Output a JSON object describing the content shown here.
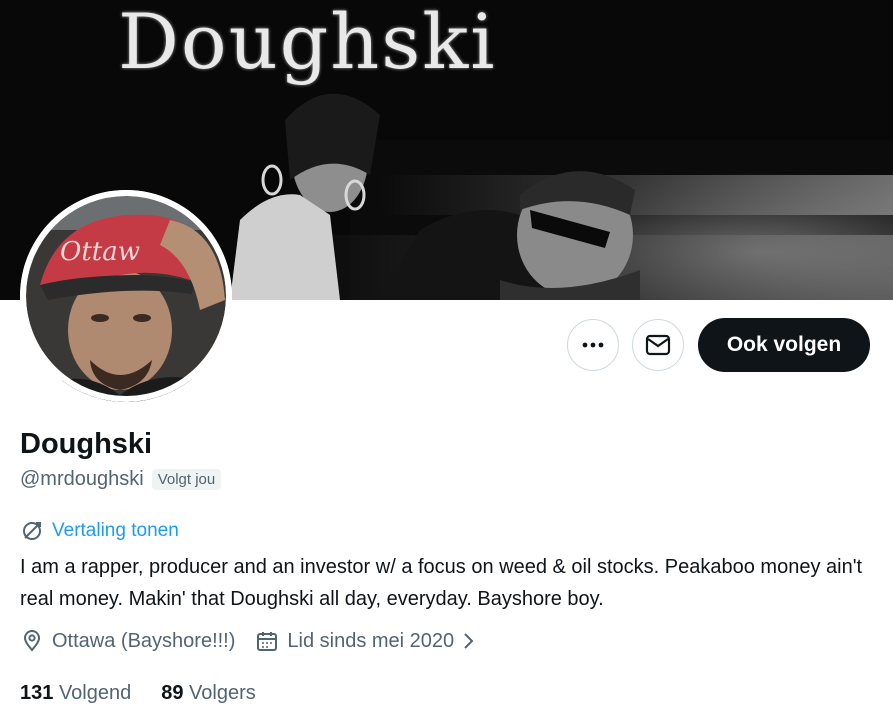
{
  "banner": {
    "title": "Doughski"
  },
  "profile": {
    "name": "Doughski",
    "handle": "@mrdoughski",
    "follows_you": "Volgt jou",
    "translate": "Vertaling tonen",
    "bio": "I am a rapper, producer and an investor w/ a focus on weed & oil stocks. Peakaboo money ain't real money. Makin' that Doughski all day, everyday. Bayshore boy.",
    "location": "Ottawa (Bayshore!!!)",
    "joined": "Lid sinds mei 2020"
  },
  "actions": {
    "more": "···",
    "follow": "Ook volgen"
  },
  "stats": {
    "following_count": "131",
    "following_label": "Volgend",
    "followers_count": "89",
    "followers_label": "Volgers"
  },
  "icons": {
    "more": "more-icon",
    "message": "envelope-icon",
    "translate": "translate-icon",
    "location": "location-pin-icon",
    "calendar": "calendar-icon",
    "chevron": "chevron-right-icon"
  },
  "colors": {
    "link": "#1d9bf0",
    "primary_button": "#0f1419",
    "muted_text": "#536471"
  }
}
